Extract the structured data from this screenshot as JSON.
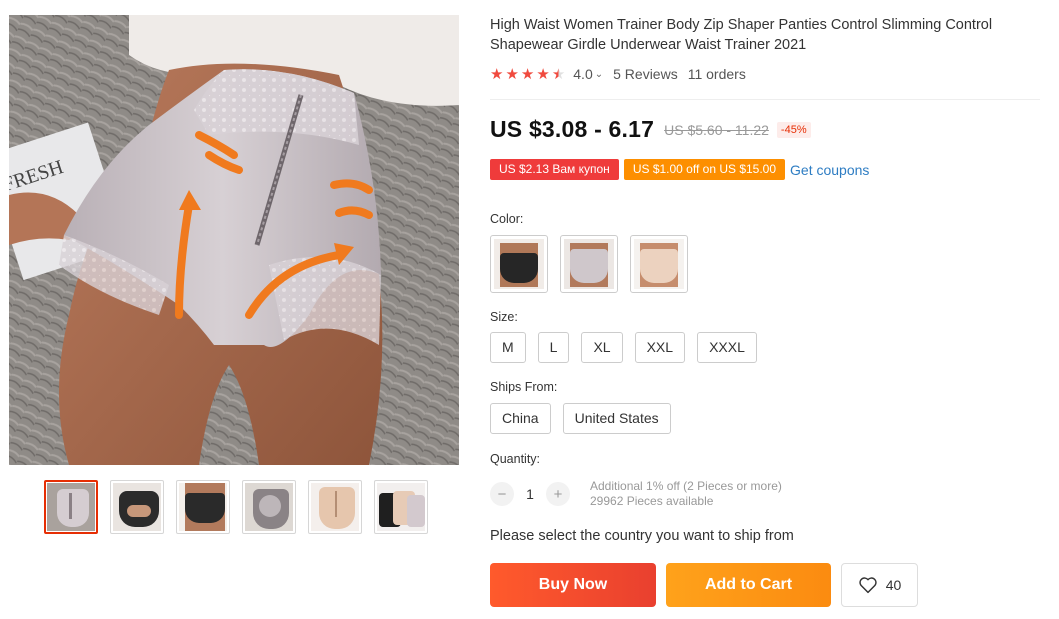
{
  "product": {
    "title": "High Waist Women Trainer Body Zip Shaper Panties Control Slimming Control Shapewear Girdle Underwear Waist Trainer 2021"
  },
  "rating": {
    "value": "4.0",
    "stars": 4.5,
    "reviews": "5 Reviews",
    "orders": "11 orders"
  },
  "price": {
    "current": "US $3.08 - 6.17",
    "original": "US $5.60 - 11.22",
    "discount": "-45%"
  },
  "coupons": [
    {
      "label": "US $2.13 Вам купон",
      "color": "#ef3b3b"
    },
    {
      "label": "US $1.00 off on US $15.00",
      "color": "#fd8f00"
    }
  ],
  "get_coupons": "Get coupons",
  "labels": {
    "color": "Color:",
    "size": "Size:",
    "ships_from": "Ships From:",
    "quantity": "Quantity:"
  },
  "colors": [
    {
      "name": "black",
      "hex": "#2b2b2b"
    },
    {
      "name": "gray",
      "hex": "#c9c2c4"
    },
    {
      "name": "beige",
      "hex": "#e9cdb8"
    }
  ],
  "sizes": [
    "M",
    "L",
    "XL",
    "XXL",
    "XXXL"
  ],
  "ships_from": [
    "China",
    "United States"
  ],
  "quantity": {
    "value": "1",
    "minus": "−",
    "plus": "+",
    "additional": "Additional 1% off (2 Pieces or more)",
    "available": "29962 Pieces available"
  },
  "ship_message": "Please select the country you want to ship from",
  "actions": {
    "buy_now": "Buy Now",
    "add_to_cart": "Add to Cart",
    "wishlist_count": "40"
  },
  "gallery": {
    "main_image_text": "FRESH",
    "thumbnails": [
      "gray-front",
      "black-back",
      "black-front",
      "gray-side",
      "beige-front",
      "stack"
    ]
  },
  "accent_colors": {
    "price_red": "#e62e04",
    "link_blue": "#2e7dc3",
    "star_red": "#f04a3e"
  }
}
